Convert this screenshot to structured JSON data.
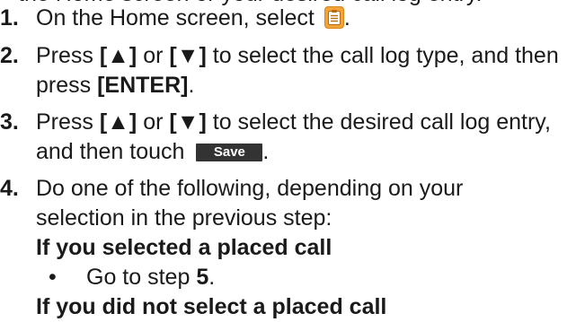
{
  "top_clipped_line": "the Home screen or your desired call log entry.",
  "steps": [
    {
      "number": "1.",
      "text_before": "On the Home screen, select",
      "icon": "call-log-icon",
      "text_after": "."
    },
    {
      "number": "2.",
      "press": "Press",
      "up_key": "[▲]",
      "or": "or",
      "down_key": "[▼]",
      "rest": "to select the call log type, and then",
      "line2_press": "press",
      "enter_key": "[ENTER]",
      "period": "."
    },
    {
      "number": "3.",
      "press": "Press",
      "up_key": "[▲]",
      "or": "or",
      "down_key": "[▼]",
      "rest": "to select the desired call log entry,",
      "line2_text": "and then touch",
      "save_label": "Save",
      "period": "."
    },
    {
      "number": "4.",
      "line1": "Do one of the following, depending on your",
      "line2": "selection in the previous step:"
    }
  ],
  "cases": [
    {
      "heading": "If you selected a placed call",
      "bullet": "•",
      "bullet_text": "Go to step",
      "step_ref": "5",
      "period": "."
    },
    {
      "heading": "If you did not select a placed call"
    }
  ],
  "colors": {
    "icon_orange": "#f2a33a",
    "save_button_bg": "#333333",
    "text": "#1a1a1a"
  }
}
